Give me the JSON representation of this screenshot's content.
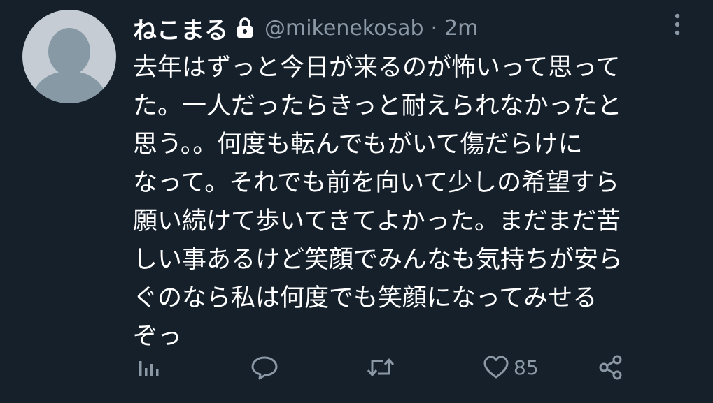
{
  "tweet": {
    "display_name": "ねこまる",
    "handle": "@mikenekosab",
    "separator": "·",
    "time": "2m",
    "body_lines": [
      "去年はずっと今日が来るのが怖いって思って",
      "た。一人だったらきっと耐えられなかったと",
      "思う。。何度も転んでもがいて傷だらけに",
      "なって。それでも前を向いて少しの希望すら",
      "願い続けて歩いてきてよかった。まだまだ苦",
      "しい事あるけど笑顔でみんなも気持ちが安ら",
      "ぐのなら私は何度でも笑顔になってみせる",
      "ぞっ"
    ],
    "like_count": "85"
  },
  "icons": {
    "avatar": "default-avatar-icon",
    "lock": "lock-icon",
    "more": "more-vertical-icon",
    "analytics": "analytics-icon",
    "reply": "reply-icon",
    "retweet": "retweet-icon",
    "like": "heart-icon",
    "share": "share-icon"
  },
  "colors": {
    "background": "#15202b",
    "primary_text": "#ffffff",
    "secondary_text": "#8b98a5",
    "avatar_bg": "#c5ccd3",
    "avatar_figure": "#8899a6"
  }
}
